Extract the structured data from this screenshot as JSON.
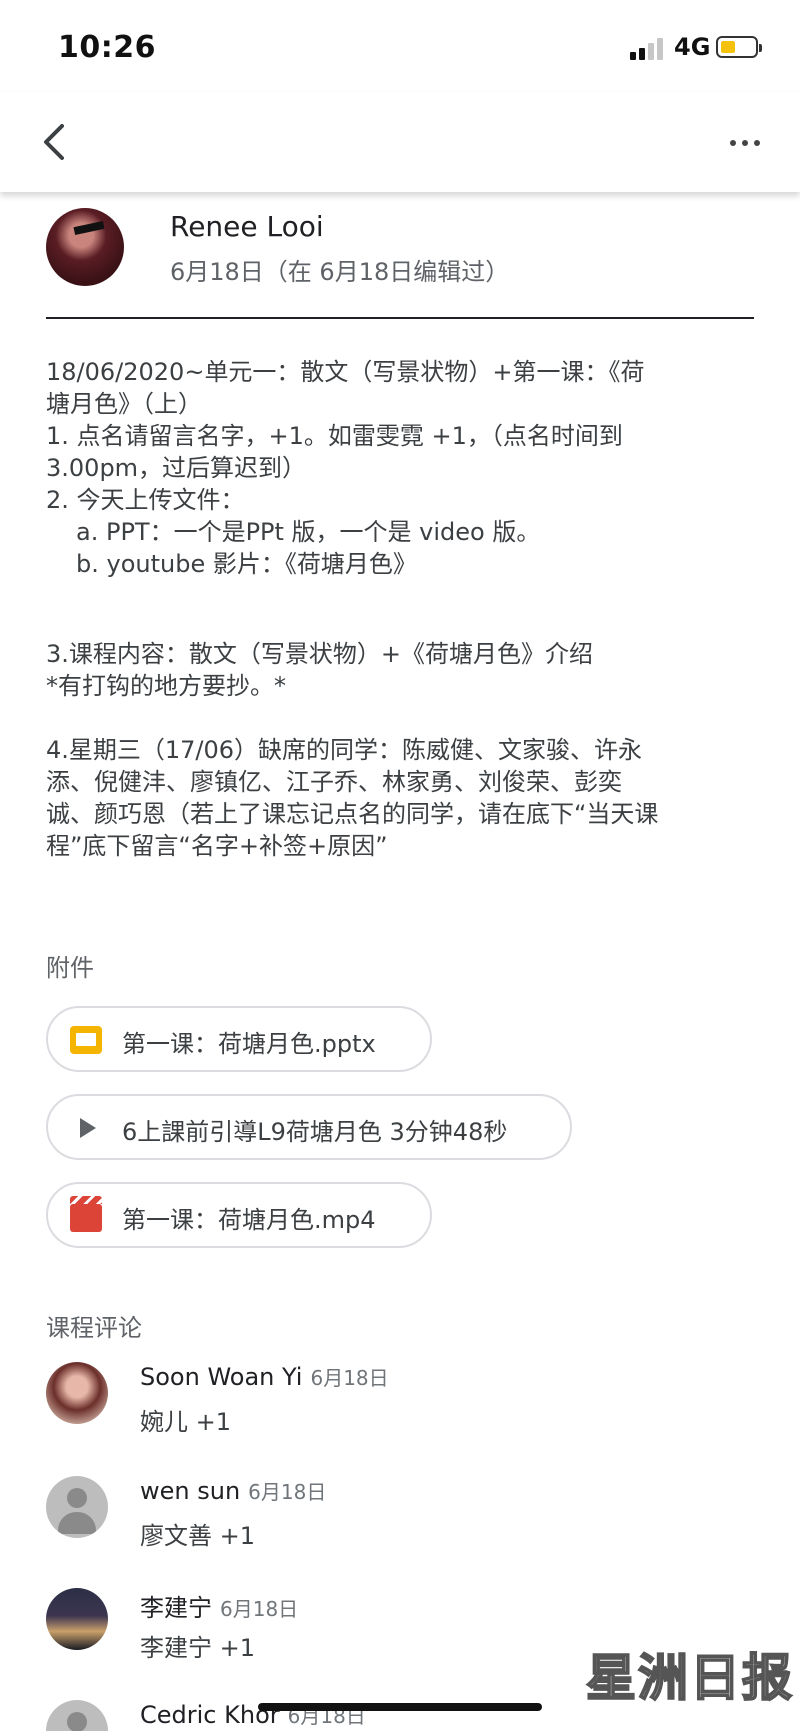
{
  "status_bar": {
    "time": "10:26",
    "network": "4G"
  },
  "post": {
    "author": "Renee Looi",
    "date": "6月18日（在 6月18日编辑过）",
    "body": {
      "line1": "18/06/2020~单元一：散文（写景状物）+第一课：《荷",
      "line2": "塘月色》（上）",
      "line3": "1. 点名请留言名字，+1。如雷雯霓 +1，（点名时间到",
      "line4": "3.00pm，过后算迟到）",
      "line5": "2. 今天上传文件：",
      "line6": "a. PPT：一个是PPt 版，一个是 video 版。",
      "line7": "b. youtube 影片：《荷塘月色》",
      "line8": "3.课程内容：散文（写景状物）+《荷塘月色》介绍",
      "line9": "*有打钩的地方要抄。*",
      "line10": "4.星期三（17/06）缺席的同学：陈威健、文家骏、许永",
      "line11": "添、倪健沣、廖镇亿、江子乔、林家勇、刘俊荣、彭奕",
      "line12": "诚、颜巧恩（若上了课忘记点名的同学，请在底下“当天课",
      "line13": "程”底下留言“名字+补签+原因”"
    }
  },
  "attachments": {
    "title": "附件",
    "items": [
      {
        "label": "第一课：荷塘月色.pptx",
        "icon": "slides-icon"
      },
      {
        "label": "6上課前引導L9荷塘月色 3分钟48秒",
        "icon": "play-icon"
      },
      {
        "label": "第一课：荷塘月色.mp4",
        "icon": "video-icon"
      }
    ]
  },
  "comments": {
    "title": "课程评论",
    "items": [
      {
        "name": "Soon Woan Yi",
        "date": "6月18日",
        "text": "婉儿 +1"
      },
      {
        "name": "wen sun",
        "date": "6月18日",
        "text": "廖文善 +1"
      },
      {
        "name": "李建宁",
        "date": "6月18日",
        "text": "李建宁 +1"
      },
      {
        "name": "Cedric Khor",
        "date": "6月18日",
        "text": ""
      }
    ]
  },
  "watermark": "星洲日报",
  "colors": {
    "slides": "#f4b400",
    "video": "#db4437",
    "text": "#3c4043",
    "secondary": "#5f6368"
  }
}
